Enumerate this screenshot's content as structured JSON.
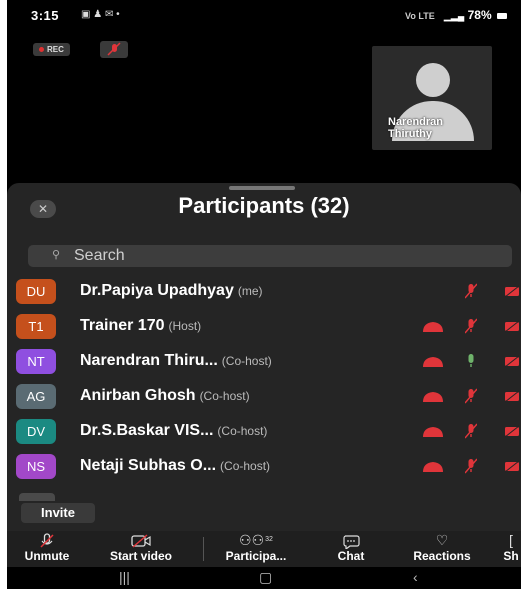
{
  "status_bar": {
    "time": "3:15",
    "signal_text": "Vo LTE",
    "battery": "78%"
  },
  "recording": {
    "label": "REC"
  },
  "video_tile": {
    "name": "Narendran Thiruthy"
  },
  "participants_panel": {
    "title": "Participants (32)",
    "search_placeholder": "Search",
    "participants": [
      {
        "initials": "DU",
        "name": "Dr.Papiya Upadhyay",
        "role": "(me)",
        "avatar_color": "#c5501c",
        "camera": false,
        "mic": "muted"
      },
      {
        "initials": "T1",
        "name": "Trainer 170",
        "role": "(Host)",
        "avatar_color": "#c5501c",
        "camera": true,
        "mic": "muted"
      },
      {
        "initials": "NT",
        "name": "Narendran Thiru...",
        "role": "(Co-host)",
        "avatar_color": "#8f4fe0",
        "camera": true,
        "mic": "on"
      },
      {
        "initials": "AG",
        "name": "Anirban Ghosh",
        "role": "(Co-host)",
        "avatar_color": "#5a6b73",
        "camera": true,
        "mic": "muted"
      },
      {
        "initials": "DV",
        "name": "Dr.S.Baskar VIS...",
        "role": "(Co-host)",
        "avatar_color": "#1b8a82",
        "camera": true,
        "mic": "muted"
      },
      {
        "initials": "NS",
        "name": "Netaji Subhas O...",
        "role": "(Co-host)",
        "avatar_color": "#a248c8",
        "camera": true,
        "mic": "muted"
      }
    ],
    "invite_label": "Invite"
  },
  "toolbar": {
    "unmute": "Unmute",
    "start_video": "Start video",
    "participants": "Participa...",
    "participants_count": "32",
    "chat": "Chat",
    "reactions": "Reactions",
    "share_partial": "Sh"
  },
  "colors": {
    "muted_red": "#e0353a",
    "mic_on_green": "#6fb36b",
    "sheet_bg": "#252525"
  }
}
